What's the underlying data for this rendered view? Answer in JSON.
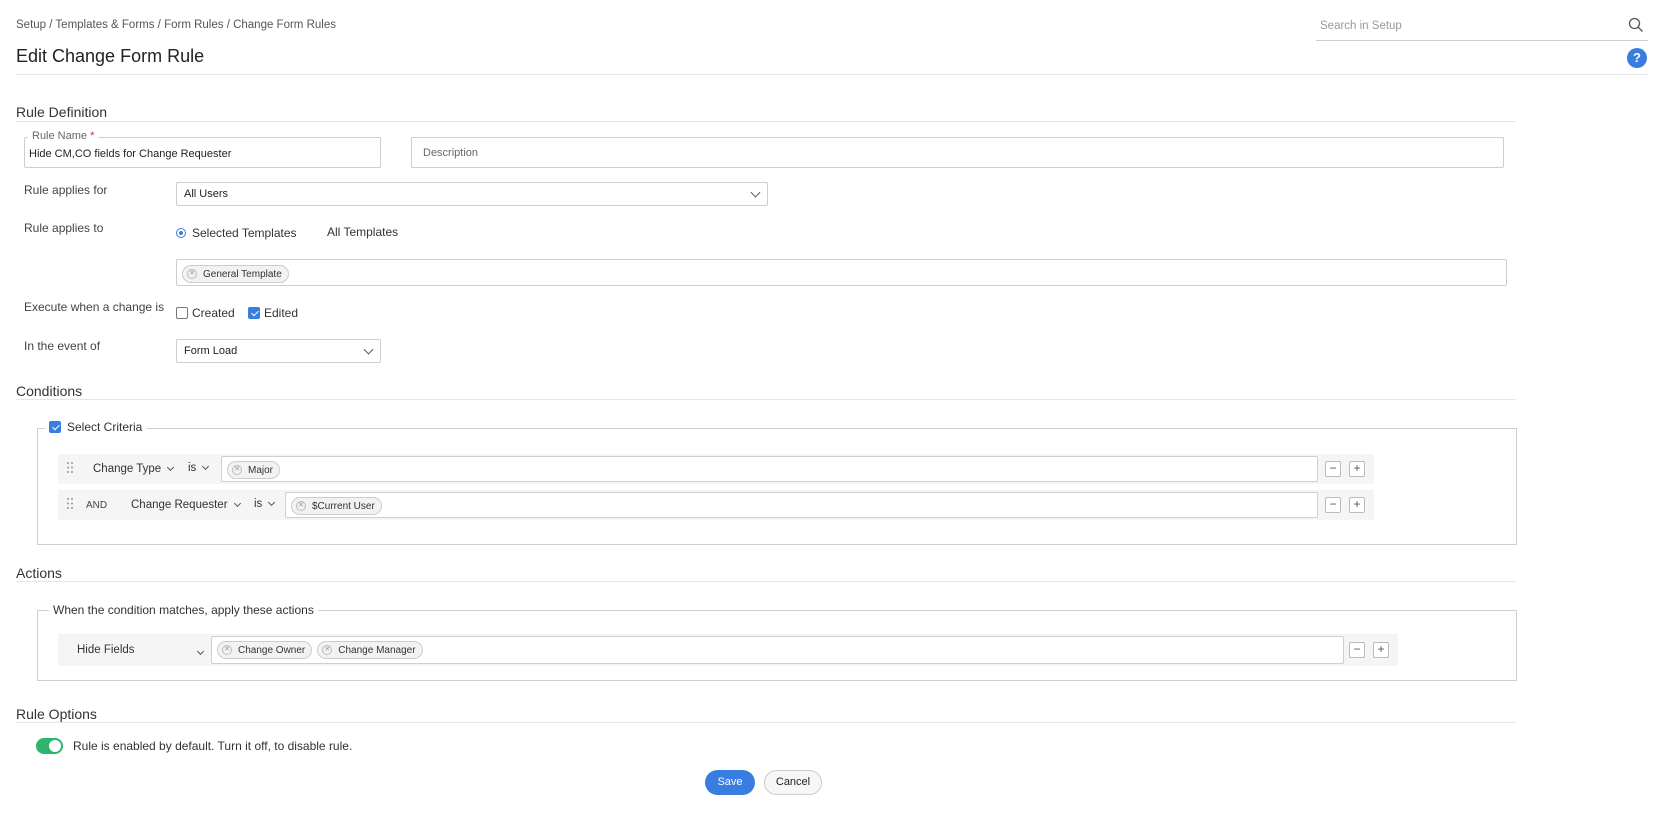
{
  "breadcrumb": "Setup / Templates & Forms / Form Rules / Change Form Rules",
  "search": {
    "placeholder": "Search in Setup"
  },
  "page_title": "Edit Change Form Rule",
  "help_label": "?",
  "sections": {
    "rule_definition": "Rule Definition",
    "conditions": "Conditions",
    "actions": "Actions",
    "rule_options": "Rule Options"
  },
  "rule_name": {
    "label": "Rule Name",
    "required_mark": "*",
    "value": "Hide CM,CO fields for Change Requester"
  },
  "description": {
    "placeholder": "Description"
  },
  "applies_for": {
    "label": "Rule applies for",
    "value": "All Users"
  },
  "applies_to": {
    "label": "Rule applies to",
    "options": [
      "Selected Templates",
      "All Templates"
    ],
    "selected": "Selected Templates",
    "templates": [
      "General Template"
    ]
  },
  "execute_when": {
    "label": "Execute when a change is",
    "created_label": "Created",
    "created_checked": false,
    "edited_label": "Edited",
    "edited_checked": true
  },
  "event": {
    "label": "In the event of",
    "value": "Form Load"
  },
  "criteria": {
    "label": "Select Criteria",
    "checked": true,
    "rows": [
      {
        "connector": "",
        "field": "Change Type",
        "operator": "is",
        "values": [
          "Major"
        ]
      },
      {
        "connector": "AND",
        "field": "Change Requester",
        "operator": "is",
        "values": [
          "$Current User"
        ]
      }
    ]
  },
  "actions": {
    "legend": "When the condition matches, apply these actions",
    "rows": [
      {
        "action": "Hide Fields",
        "values": [
          "Change Owner",
          "Change Manager"
        ]
      }
    ]
  },
  "options": {
    "toggle_on": true,
    "text": "Rule is enabled by default. Turn it off, to disable rule."
  },
  "buttons": {
    "save": "Save",
    "cancel": "Cancel"
  },
  "colors": {
    "accent": "#3a7de0",
    "toggle": "#2fb56b"
  }
}
